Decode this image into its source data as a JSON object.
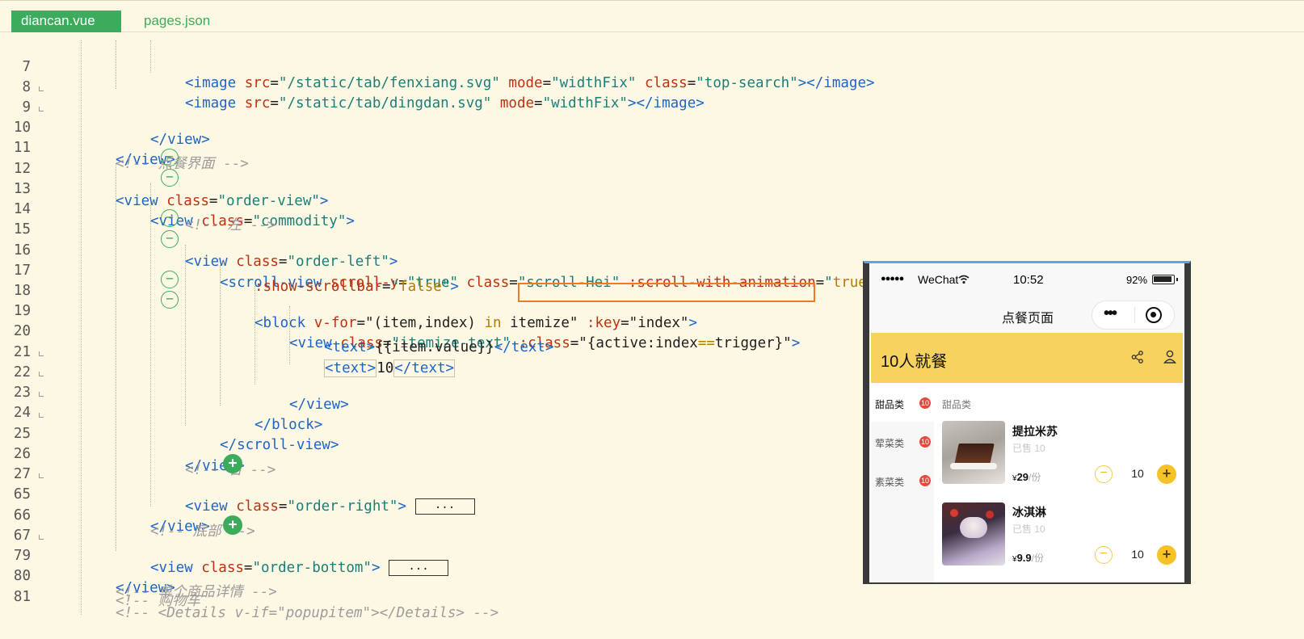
{
  "tabs": [
    {
      "label": "diancan.vue",
      "active": true
    },
    {
      "label": "pages.json",
      "active": false
    }
  ],
  "lines": [
    {
      "n": "7"
    },
    {
      "n": "8"
    },
    {
      "n": "9"
    },
    {
      "n": "10"
    },
    {
      "n": "11"
    },
    {
      "n": "12"
    },
    {
      "n": "13"
    },
    {
      "n": "14"
    },
    {
      "n": "15"
    },
    {
      "n": "16"
    },
    {
      "n": "17"
    },
    {
      "n": "18"
    },
    {
      "n": "19"
    },
    {
      "n": "20"
    },
    {
      "n": "21"
    },
    {
      "n": "22"
    },
    {
      "n": "23"
    },
    {
      "n": "24"
    },
    {
      "n": "25"
    },
    {
      "n": "26"
    },
    {
      "n": "27"
    },
    {
      "n": "65"
    },
    {
      "n": "66"
    },
    {
      "n": "67"
    },
    {
      "n": "79"
    },
    {
      "n": "80"
    },
    {
      "n": "81"
    }
  ],
  "collapsed_label": "...",
  "phone": {
    "signal": "●●●●●",
    "carrier": "WeChat",
    "time": "10:52",
    "battery": "92%",
    "page_title": "点餐页面",
    "capsule_dots": "•••",
    "hero_title": "10人就餐",
    "section_title": "甜品类",
    "categories": [
      {
        "label": "甜品类",
        "badge": "10"
      },
      {
        "label": "荤菜类",
        "badge": "10"
      },
      {
        "label": "素菜类",
        "badge": "10"
      }
    ],
    "products": [
      {
        "name": "提拉米苏",
        "sold": "已售 10",
        "currency": "¥",
        "price": "29",
        "unit": "/份",
        "qty": "10"
      },
      {
        "name": "冰淇淋",
        "sold": "已售 10",
        "currency": "¥",
        "price": "9.9",
        "unit": "/份",
        "qty": "10"
      }
    ],
    "minus_glyph": "−",
    "plus_glyph": "+"
  },
  "colors": {
    "accent": "#3cab5b",
    "highlight_box": "#f07a22",
    "hero": "#f8d25e"
  }
}
